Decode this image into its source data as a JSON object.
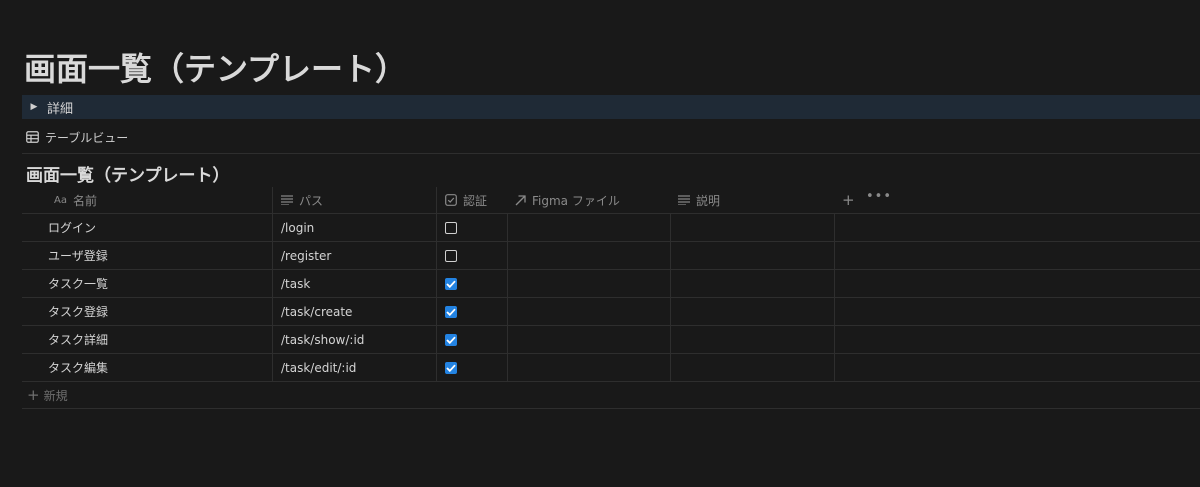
{
  "page": {
    "title": "画面一覧（テンプレート）"
  },
  "toggle": {
    "label": "詳細"
  },
  "view": {
    "label": "テーブルビュー"
  },
  "database": {
    "title": "画面一覧（テンプレート）",
    "columns": {
      "name": {
        "icon_text": "Aa",
        "label": "名前"
      },
      "path": {
        "label": "パス"
      },
      "auth": {
        "label": "認証"
      },
      "figma": {
        "label": "Figma ファイル"
      },
      "description": {
        "label": "説明"
      }
    },
    "add_column_label": "+",
    "more_label": "•••",
    "rows": [
      {
        "name": "ログイン",
        "path": "/login",
        "auth": false
      },
      {
        "name": "ユーザ登録",
        "path": "/register",
        "auth": false
      },
      {
        "name": "タスク一覧",
        "path": "/task",
        "auth": true
      },
      {
        "name": "タスク登録",
        "path": "/task/create",
        "auth": true
      },
      {
        "name": "タスク詳細",
        "path": "/task/show/:id",
        "auth": true
      },
      {
        "name": "タスク編集",
        "path": "/task/edit/:id",
        "auth": true
      }
    ],
    "new_label": "新規"
  },
  "colors": {
    "background": "#191919",
    "toggle_highlight": "#1f2a36",
    "checkbox_accent": "#2383e2"
  }
}
